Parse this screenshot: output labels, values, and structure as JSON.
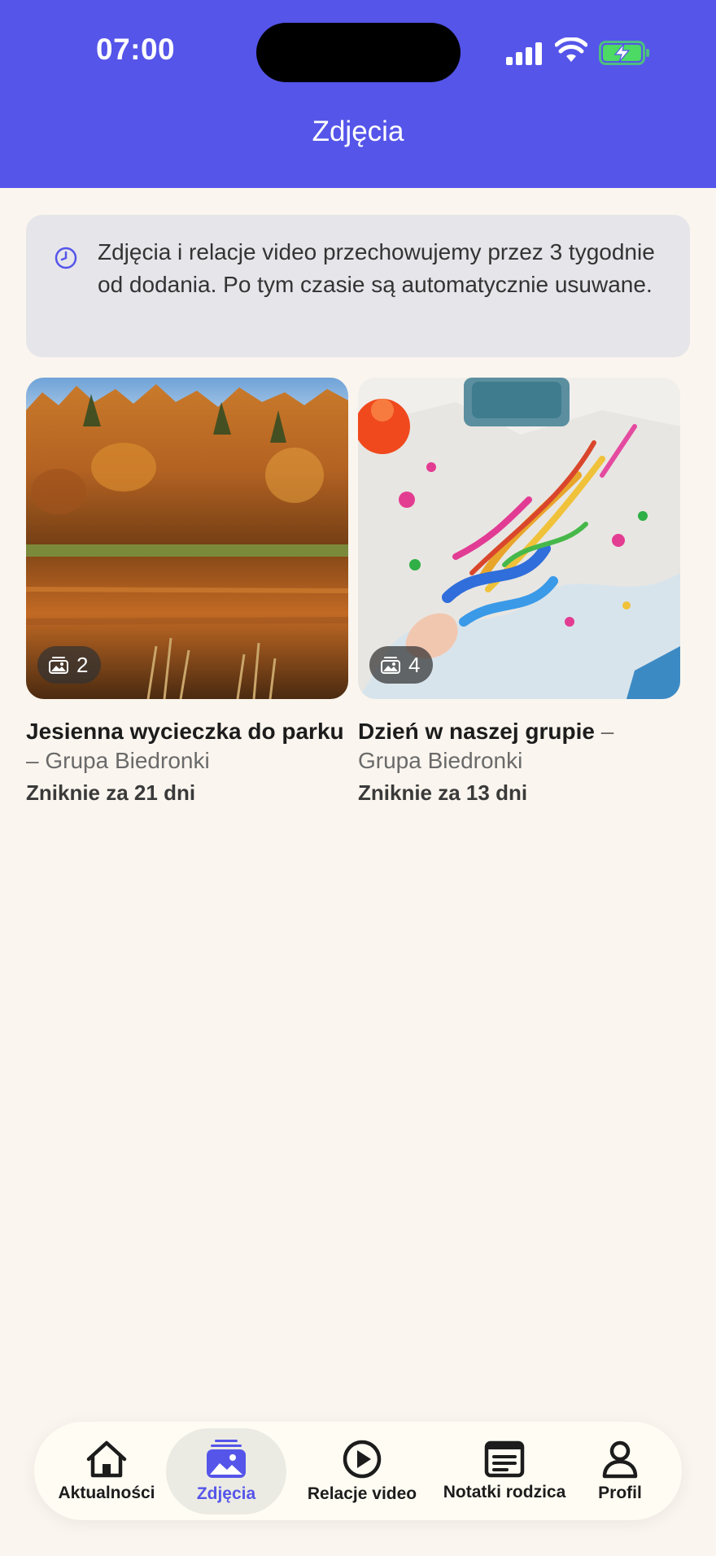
{
  "status_bar": {
    "time": "07:00"
  },
  "header": {
    "title": "Zdjęcia"
  },
  "notice": {
    "text": "Zdjęcia i relacje video przechowujemy przez 3 tygodnie od dodania. Po tym czasie są automatycznie usuwane.",
    "icon": "clock-icon"
  },
  "albums": [
    {
      "title": "Jesienna wycieczka do parku",
      "group": "– Grupa Biedronki",
      "photo_count": "2",
      "expiry": "Zniknie za 21 dni"
    },
    {
      "title": "Dzień w naszej grupie",
      "group": "– Grupa Biedronki",
      "photo_count": "4",
      "expiry": "Zniknie za 13 dni"
    }
  ],
  "nav": {
    "active": "Zdjęcia",
    "items": [
      {
        "label": "Aktualności",
        "icon": "home-icon"
      },
      {
        "label": "Zdjęcia",
        "icon": "photos-icon"
      },
      {
        "label": "Relacje video",
        "icon": "play-icon"
      },
      {
        "label": "Notatki rodzica",
        "icon": "notes-icon"
      },
      {
        "label": "Profil",
        "icon": "profile-icon"
      }
    ]
  },
  "colors": {
    "brand": "#5555EA",
    "background": "#FAF5EE",
    "notice_bg": "#E6E5EA",
    "battery_green": "#4CD964"
  }
}
